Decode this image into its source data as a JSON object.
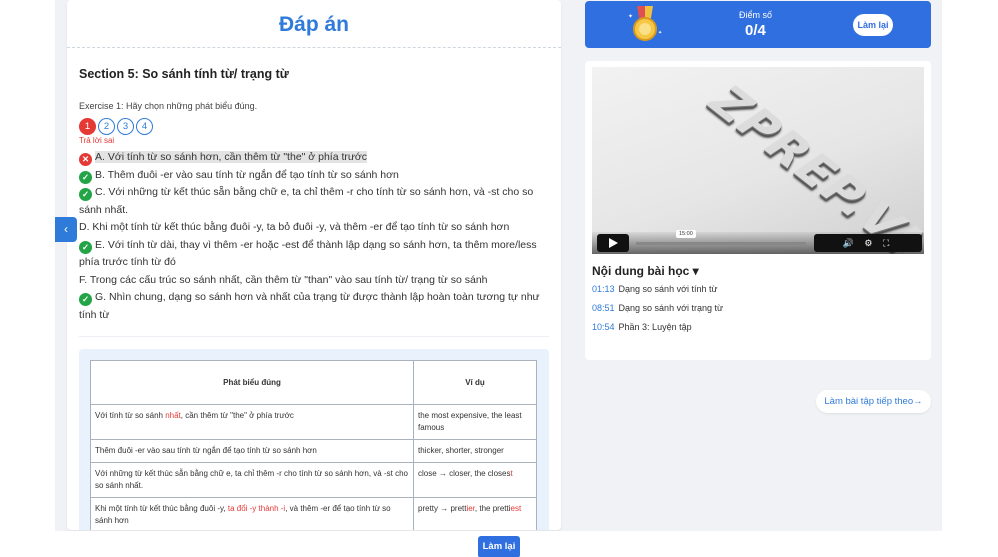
{
  "answer_title": "Đáp án",
  "section_title": "Section 5: So sánh tính từ/ trạng từ",
  "exercise_label": "Exercise 1: Hãy chọn những phát biểu đúng.",
  "question_numbers": [
    "1",
    "2",
    "3",
    "4"
  ],
  "wrong_label": "Trả lời sai",
  "statements": [
    {
      "icon": "wrong",
      "text": "A. Với tính từ so sánh hơn, cần thêm từ \"the\" ở phía trước"
    },
    {
      "icon": "correct",
      "text": "B. Thêm đuôi -er vào sau tính từ ngắn để tạo tính từ so sánh hơn"
    },
    {
      "icon": "correct",
      "text": "C. Với những từ kết thúc sẵn bằng chữ e, ta chỉ thêm -r cho tính từ so sánh hơn, và -st cho so sánh nhất."
    },
    {
      "icon": "none",
      "text": "D. Khi một tính từ kết thúc bằng đuôi -y, ta bỏ đuôi -y, và thêm -er để tạo tính từ so sánh hơn"
    },
    {
      "icon": "correct",
      "text": "E. Với tính từ dài, thay vì thêm -er hoặc -est để thành lập dạng so sánh hơn, ta thêm more/less phía trước tính từ đó"
    },
    {
      "icon": "none",
      "text": "F. Trong các cấu trúc so sánh nhất, cần thêm từ \"than\" vào sau tính từ/ trạng từ so sánh"
    },
    {
      "icon": "correct",
      "text": "G. Nhìn chung, dạng so sánh hơn và nhất của trạng từ được thành lập hoàn toàn tương tự như tính từ"
    }
  ],
  "table": {
    "headers": [
      "Phát biểu đúng",
      "Ví dụ"
    ],
    "rows": [
      {
        "a1": "Với tính từ so sánh ",
        "a_red": "nhất",
        "a2": ", cần thêm từ \"the\" ở phía trước",
        "b1": "the most expensive, the least famous",
        "b_red": "",
        "b2": "",
        "b_red2": "",
        "b3": ""
      },
      {
        "a1": "Thêm đuôi -er vào sau tính từ ngắn để tạo tính từ so sánh hơn",
        "a_red": "",
        "a2": "",
        "b1": "thicker, shorter, stronger",
        "b_red": "",
        "b2": "",
        "b_red2": "",
        "b3": ""
      },
      {
        "a1": "Với những từ kết thúc sẵn bằng chữ e, ta chỉ thêm -r cho tính từ so sánh hơn, và -st cho so sánh nhất.",
        "a_red": "",
        "a2": "",
        "b1": "close → closer, the closes",
        "b_red": "t",
        "b2": "",
        "b_red2": "",
        "b3": ""
      },
      {
        "a1": "Khi một tính từ kết thúc bằng đuôi -y, ",
        "a_red": "ta đổi -y thành -i",
        "a2": ", và thêm -er để tạo tính từ so sánh hơn",
        "b1": "pretty → prett",
        "b_red": "ier",
        "b2": ", the pretti",
        "b_red2": "est",
        "b3": ""
      }
    ]
  },
  "score": {
    "label": "Điểm số",
    "value": "0/4",
    "retry": "Làm lại"
  },
  "video": {
    "logo": "ZPREP.VN",
    "tooltip": "15:00"
  },
  "toc": {
    "title": "Nội dung bài học",
    "items": [
      {
        "time": "01:13",
        "label": "Dạng so sánh với tính từ"
      },
      {
        "time": "08:51",
        "label": "Dạng so sánh với trạng từ"
      },
      {
        "time": "10:54",
        "label": "Phần 3: Luyện tập"
      }
    ]
  },
  "next_button": "Làm bài tập tiếp theo→",
  "bottom_retry": "Làm lại",
  "icons": {
    "collapse": "chevron-left-icon",
    "medal": "medal-icon",
    "dropdown": "caret-down-icon"
  },
  "colors": {
    "primary": "#2f6fe0",
    "link": "#2f7bd9",
    "correct": "#22a447",
    "wrong": "#e53935"
  }
}
